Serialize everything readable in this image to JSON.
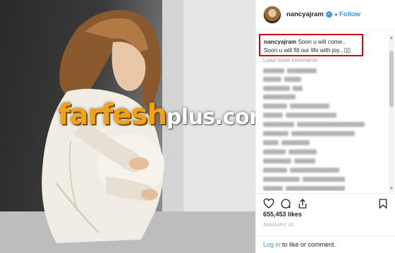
{
  "post": {
    "username": "nancyajram",
    "follow_label": "Follow",
    "separator": "•",
    "caption_text_line1": "Soon u will come..",
    "caption_text_line2": "Soon u will fill our life with joy.. ",
    "caption_emojis": "▯▯",
    "load_more_label": "Load more comments",
    "likes": "655,453 likes",
    "date": "JANUARY 13",
    "verified_icon": "✓"
  },
  "footer": {
    "login_label": "Log in",
    "middle_text": " to like or ",
    "comment_label": "comment."
  },
  "watermark": {
    "part1": "farfesh",
    "part2": "plus.com"
  },
  "colors": {
    "accent": "#3897f0",
    "highlight_border": "#d0021b",
    "watermark_orange": "#f0a31a"
  },
  "icons": [
    "heart-icon",
    "comment-icon",
    "share-icon",
    "bookmark-icon",
    "verified-badge-icon"
  ]
}
